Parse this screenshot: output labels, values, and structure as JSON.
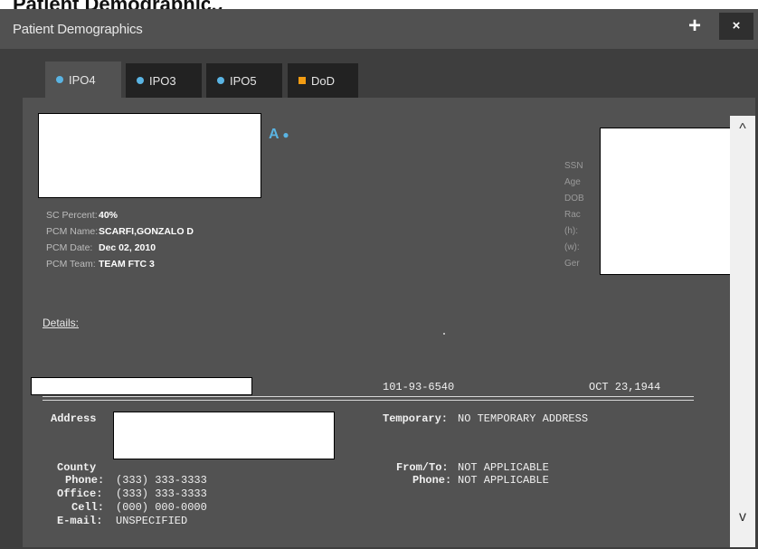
{
  "heading": "Patient Demographics",
  "window": {
    "title": "Patient Demographics",
    "add_icon": "+",
    "close_icon": "×"
  },
  "tabs": [
    {
      "label": "IPO4",
      "marker": "dot",
      "color": "#5ab4e3",
      "active": true
    },
    {
      "label": "IPO3",
      "marker": "dot",
      "color": "#5ab4e3",
      "active": false
    },
    {
      "label": "IPO5",
      "marker": "dot",
      "color": "#5ab4e3",
      "active": false
    },
    {
      "label": "DoD",
      "marker": "square",
      "color": "#f39c12",
      "active": false
    }
  ],
  "patient": {
    "name_tail": "A",
    "status_dot_color": "#5ab4e3"
  },
  "summary": {
    "sc_percent_label": "SC Percent:",
    "sc_percent": "40%",
    "pcm_name_label": "PCM Name:",
    "pcm_name": "SCARFI,GONZALO D",
    "pcm_date_label": "PCM Date:",
    "pcm_date": "Dec 02, 2010",
    "pcm_team_label": "PCM Team:",
    "pcm_team": "TEAM FTC 3"
  },
  "right_labels": [
    "SSN",
    "Age",
    "DOB",
    "Rac",
    "(h):",
    "(w):",
    "Ger"
  ],
  "details": {
    "heading": "Details:",
    "ssn": "101-93-6540",
    "dob": "OCT 23,1944",
    "separator": "================================================================================================================",
    "address_label": "Address",
    "temporary_label": "Temporary:",
    "temporary_value": "NO TEMPORARY ADDRESS",
    "county_label": "County",
    "phone_label": "Phone:",
    "phone": "(333) 333-3333",
    "office_label": "Office:",
    "office": "(333) 333-3333",
    "cell_label": "Cell:",
    "cell": "(000) 000-0000",
    "email_label": "E-mail:",
    "email": "UNSPECIFIED",
    "fromto_label": "From/To:",
    "fromto_value": "NOT APPLICABLE",
    "temp_phone_label": "Phone:",
    "temp_phone_value": "NOT APPLICABLE"
  },
  "scrollbar": {
    "up_icon": "^",
    "down_icon": "v"
  }
}
